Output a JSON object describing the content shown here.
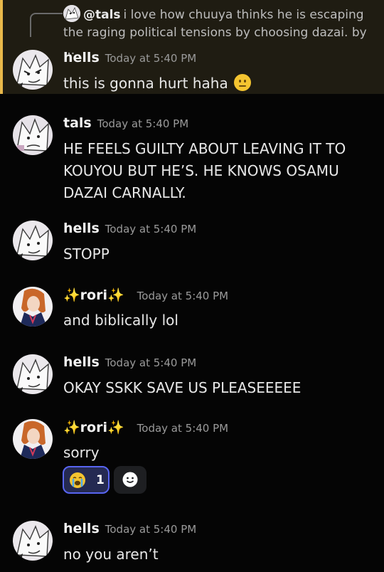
{
  "reply": {
    "author": "@tals",
    "text": "i love how chuuya thinks he is escaping the raging political tensions by choosing dazai. by ..."
  },
  "messages": [
    {
      "author": "hells",
      "time": "Today at 5:40 PM",
      "text": "this is gonna hurt haha"
    },
    {
      "author": "tals",
      "time": "Today at 5:40 PM",
      "text": "HE FEELS GUILTY ABOUT LEAVING IT TO KOUYOU BUT HE’S. HE KNOWS OSAMU DAZAI CARNALLY."
    },
    {
      "author": "hells",
      "time": "Today at 5:40 PM",
      "text": "STOPP"
    },
    {
      "author": "rori",
      "time": "Today at 5:40 PM",
      "text": "and biblically lol"
    },
    {
      "author": "hells",
      "time": "Today at 5:40 PM",
      "text": "OKAY SSKK SAVE US PLEASEEEEE"
    },
    {
      "author": "rori",
      "time": "Today at 5:40 PM",
      "text": "sorry"
    },
    {
      "author": "hells",
      "time": "Today at 5:40 PM",
      "text": "no you aren’t"
    }
  ],
  "reaction": {
    "emoji": "loudly-crying-face",
    "count": "1"
  },
  "colors": {
    "highlight_bar": "#e8b84a",
    "reaction_border": "#5865f2",
    "background": "#050505"
  }
}
